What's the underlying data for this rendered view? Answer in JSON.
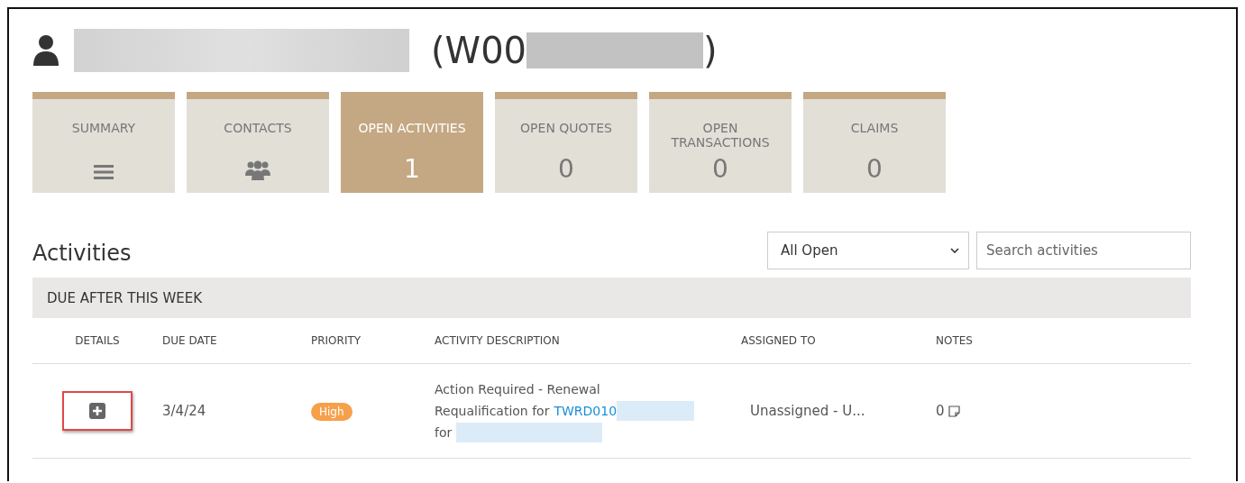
{
  "header": {
    "title_start": "(W00",
    "title_end": ")"
  },
  "tiles": [
    {
      "label": "SUMMARY",
      "kind": "list",
      "selected": false
    },
    {
      "label": "CONTACTS",
      "kind": "people",
      "selected": false
    },
    {
      "label": "OPEN ACTIVITIES",
      "kind": "count",
      "count": "1",
      "selected": true
    },
    {
      "label": "OPEN QUOTES",
      "kind": "count",
      "count": "0",
      "selected": false
    },
    {
      "label": "OPEN TRANSACTIONS",
      "kind": "count",
      "count": "0",
      "selected": false
    },
    {
      "label": "CLAIMS",
      "kind": "count",
      "count": "0",
      "selected": false
    }
  ],
  "activities": {
    "title": "Activities",
    "filter": {
      "value": "All Open"
    },
    "search": {
      "placeholder": "Search activities"
    },
    "group": "DUE AFTER THIS WEEK",
    "columns": [
      "DETAILS",
      "DUE DATE",
      "PRIORITY",
      "ACTIVITY DESCRIPTION",
      "ASSIGNED TO",
      "NOTES"
    ],
    "rows": [
      {
        "highlighted": true,
        "due_date": "3/4/24",
        "priority": "High",
        "description": {
          "line_1": "Action Required - Renewal",
          "line_2": "Requalification for",
          "link": "TWRD010",
          "line_3": "for"
        },
        "assigned_to": "Unassigned - U...",
        "notes": "0"
      }
    ]
  }
}
